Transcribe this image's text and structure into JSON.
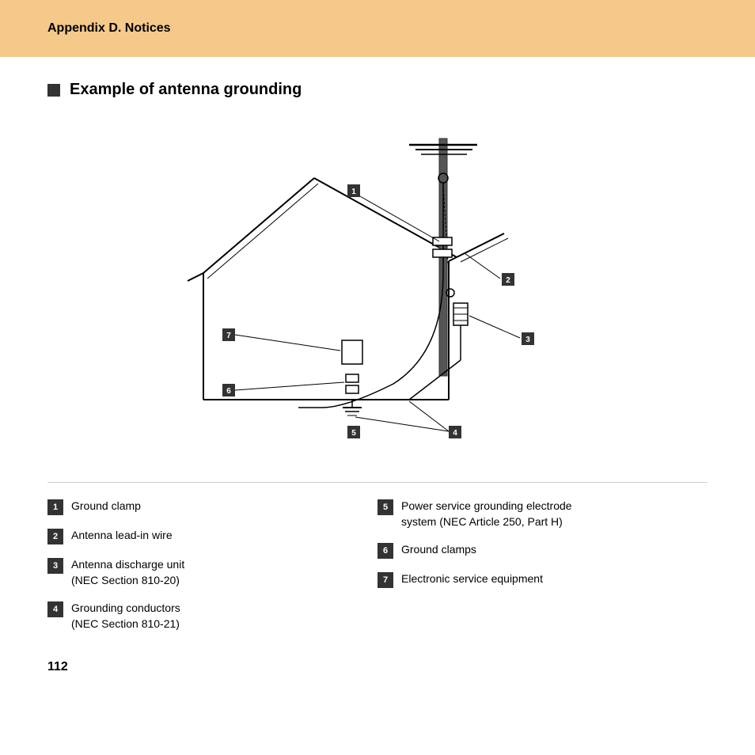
{
  "header": {
    "title": "Appendix D. Notices"
  },
  "section": {
    "heading": "Example of antenna grounding"
  },
  "legend": {
    "items": [
      {
        "id": "1",
        "text": "Ground clamp"
      },
      {
        "id": "2",
        "text": "Antenna lead-in wire"
      },
      {
        "id": "3",
        "text": "Antenna discharge unit\n(NEC Section 810-20)"
      },
      {
        "id": "4",
        "text": "Grounding conductors\n(NEC Section 810-21)"
      },
      {
        "id": "5",
        "text": "Power service grounding electrode\nsystem (NEC Article 250, Part H)"
      },
      {
        "id": "6",
        "text": "Ground clamps"
      },
      {
        "id": "7",
        "text": "Electronic service equipment"
      }
    ]
  },
  "page_number": "112"
}
